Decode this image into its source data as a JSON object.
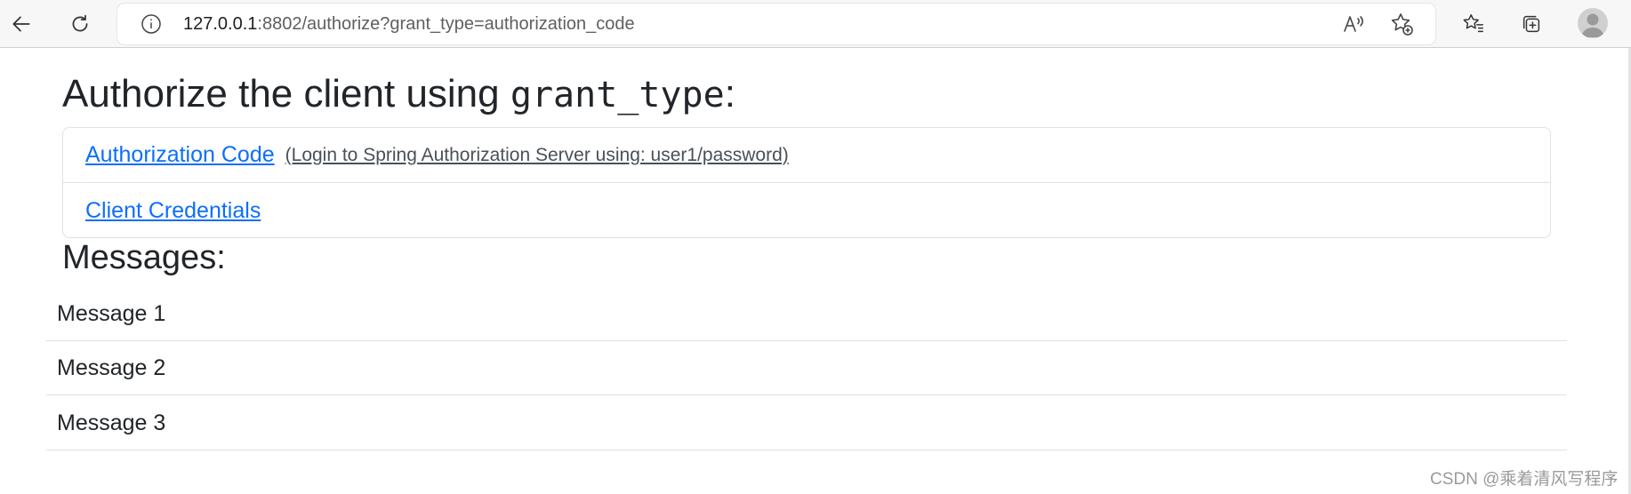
{
  "browser": {
    "url_host": "127.0.0.1",
    "url_rest": ":8802/authorize?grant_type=authorization_code",
    "icons": [
      "back-arrow-icon",
      "refresh-icon",
      "site-info-icon",
      "read-aloud-icon",
      "add-favorite-icon",
      "favorites-icon",
      "collections-icon",
      "profile-avatar-icon"
    ]
  },
  "page": {
    "title_prefix": "Authorize the client using ",
    "title_code": "grant_type",
    "title_suffix": ":",
    "grant_options": [
      {
        "label": "Authorization Code",
        "hint": "(Login to Spring Authorization Server using: user1/password)"
      },
      {
        "label": "Client Credentials",
        "hint": ""
      }
    ],
    "messages_title": "Messages:",
    "messages": [
      "Message 1",
      "Message 2",
      "Message 3"
    ]
  },
  "watermark": "CSDN @乘着清风写程序",
  "colors": {
    "link": "#0d6efd",
    "text": "#212529",
    "border": "#dee2e6"
  }
}
